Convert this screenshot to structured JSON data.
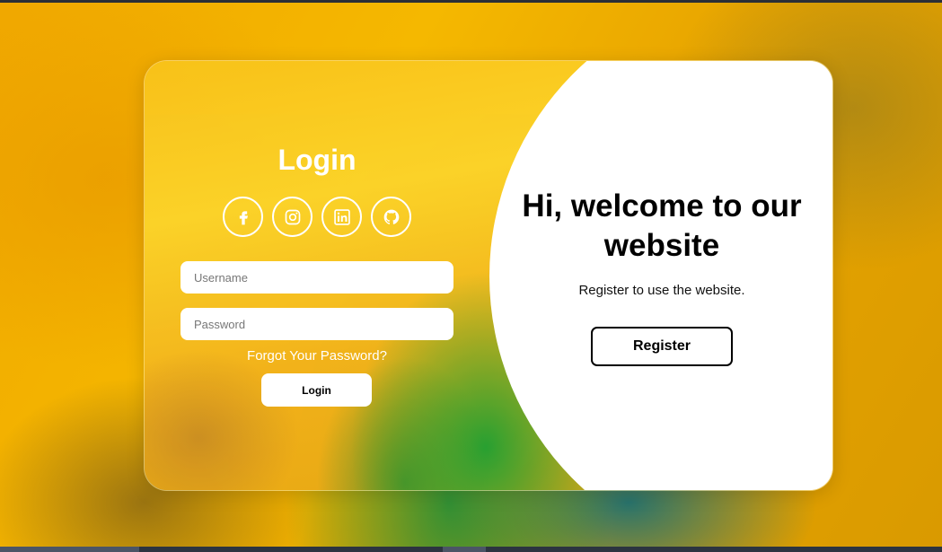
{
  "login": {
    "title": "Login",
    "socials": [
      {
        "icon": "facebook-icon"
      },
      {
        "icon": "instagram-icon"
      },
      {
        "icon": "linkedin-icon"
      },
      {
        "icon": "github-icon"
      }
    ],
    "username_placeholder": "Username",
    "password_placeholder": "Password",
    "forgot_label": "Forgot Your Password?",
    "button_label": "Login"
  },
  "welcome": {
    "title": "Hi, welcome to our website",
    "subtitle": "Register to use the website.",
    "register_label": "Register"
  },
  "colors": {
    "accent_yellow": "#f5b800",
    "accent_green": "#23a032",
    "panel_white": "#ffffff"
  }
}
